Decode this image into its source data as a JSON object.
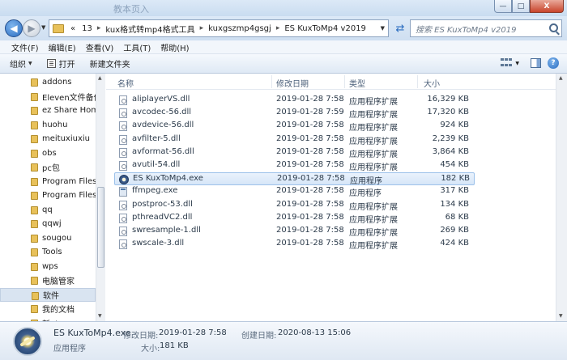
{
  "window": {
    "ghost_title": "教本页入",
    "buttons": {
      "minimize": "—",
      "maximize": "□",
      "close": "X"
    }
  },
  "address": {
    "chevrons": "«",
    "crumbs": [
      "13",
      "kux格式转mp4格式工具",
      "kuxgszmp4gsgj",
      "ES KuxToMp4 v2019"
    ],
    "separator": "▸",
    "search_placeholder": "搜索 ES KuxToMp4 v2019"
  },
  "menu": [
    "文件(F)",
    "编辑(E)",
    "查看(V)",
    "工具(T)",
    "帮助(H)"
  ],
  "toolbar": {
    "organize": "组织",
    "open": "打开",
    "new_folder": "新建文件夹"
  },
  "sidebar": {
    "items": [
      "addons",
      "Eleven文件备份",
      "ez Share Hom",
      "huohu",
      "meituxiuxiu",
      "obs",
      "pc包",
      "Program Files",
      "Program Files",
      "qq",
      "qqwj",
      "sougou",
      "Tools",
      "wps",
      "电脑管家",
      "软件",
      "我的文档",
      "新ahc"
    ],
    "selected_index": 15
  },
  "columns": {
    "name": "名称",
    "date": "修改日期",
    "type": "类型",
    "size": "大小"
  },
  "files": [
    {
      "name": "aliplayerVS.dll",
      "date": "2019-01-28 7:58",
      "type": "应用程序扩展",
      "size": "16,329 KB",
      "icon": "dll"
    },
    {
      "name": "avcodec-56.dll",
      "date": "2019-01-28 7:59",
      "type": "应用程序扩展",
      "size": "17,320 KB",
      "icon": "dll"
    },
    {
      "name": "avdevice-56.dll",
      "date": "2019-01-28 7:58",
      "type": "应用程序扩展",
      "size": "924 KB",
      "icon": "dll"
    },
    {
      "name": "avfilter-5.dll",
      "date": "2019-01-28 7:58",
      "type": "应用程序扩展",
      "size": "2,239 KB",
      "icon": "dll"
    },
    {
      "name": "avformat-56.dll",
      "date": "2019-01-28 7:58",
      "type": "应用程序扩展",
      "size": "3,864 KB",
      "icon": "dll"
    },
    {
      "name": "avutil-54.dll",
      "date": "2019-01-28 7:58",
      "type": "应用程序扩展",
      "size": "454 KB",
      "icon": "dll"
    },
    {
      "name": "ES KuxToMp4.exe",
      "date": "2019-01-28 7:58",
      "type": "应用程序",
      "size": "182 KB",
      "icon": "app",
      "selected": true
    },
    {
      "name": "ffmpeg.exe",
      "date": "2019-01-28 7:58",
      "type": "应用程序",
      "size": "317 KB",
      "icon": "exe"
    },
    {
      "name": "postproc-53.dll",
      "date": "2019-01-28 7:58",
      "type": "应用程序扩展",
      "size": "134 KB",
      "icon": "dll"
    },
    {
      "name": "pthreadVC2.dll",
      "date": "2019-01-28 7:58",
      "type": "应用程序扩展",
      "size": "68 KB",
      "icon": "dll"
    },
    {
      "name": "swresample-1.dll",
      "date": "2019-01-28 7:58",
      "type": "应用程序扩展",
      "size": "269 KB",
      "icon": "dll"
    },
    {
      "name": "swscale-3.dll",
      "date": "2019-01-28 7:58",
      "type": "应用程序扩展",
      "size": "424 KB",
      "icon": "dll"
    }
  ],
  "details": {
    "name": "ES KuxToMp4.exe",
    "type": "应用程序",
    "modified_label": "修改日期:",
    "modified_value": "2019-01-28 7:58",
    "created_label": "创建日期:",
    "created_value": "2020-08-13 15:06",
    "size_label": "大小:",
    "size_value": "181 KB"
  }
}
